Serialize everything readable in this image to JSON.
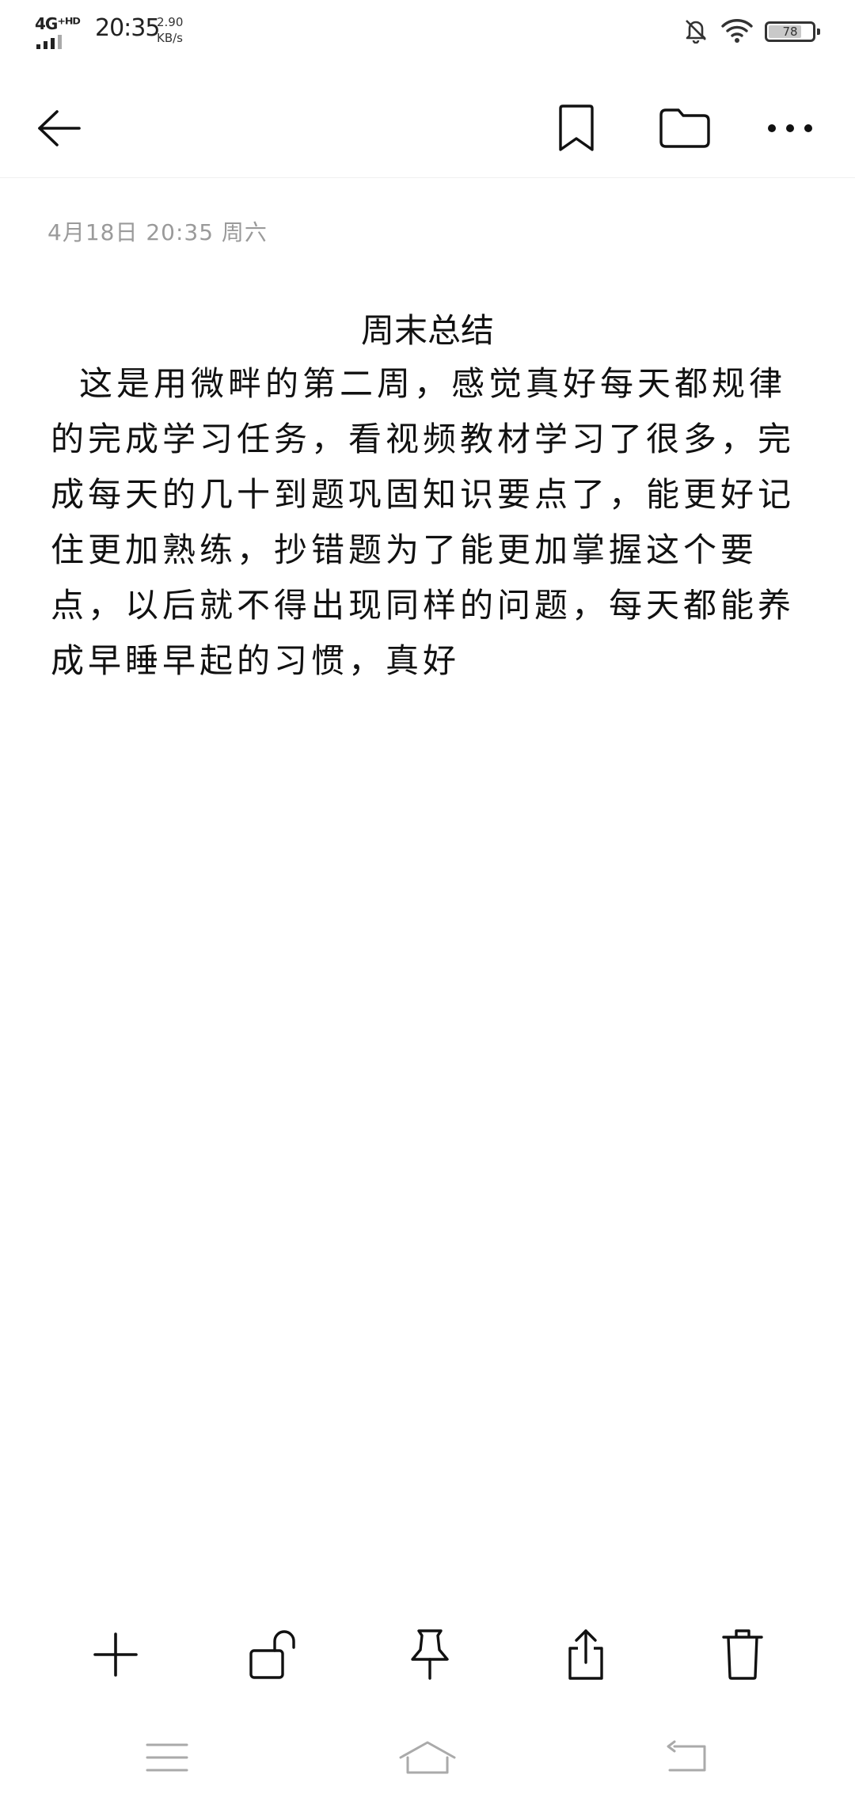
{
  "status_bar": {
    "network_type": "4G⁺ᴴᴰ",
    "time": "20:35",
    "speed_value": "2.90",
    "speed_unit": "KB/s",
    "battery_level": "78"
  },
  "toolbar": {
    "back_icon": "arrow-left-icon",
    "bookmark_icon": "bookmark-icon",
    "folder_icon": "folder-icon",
    "more_icon": "more-icon"
  },
  "note": {
    "meta": "4月18日 20:35 周六",
    "title": "周末总结",
    "body": "这是用微畔的第二周，感觉真好每天都规律的完成学习任务，看视频教材学习了很多，完成每天的几十到题巩固知识要点了，能更好记住更加熟练，抄错题为了能更加掌握这个要点，以后就不得出现同样的问题，每天都能养成早睡早起的习惯，真好"
  },
  "bottom_actions": {
    "icons": [
      "plus-icon",
      "unlock-icon",
      "pin-icon",
      "share-icon",
      "trash-icon"
    ]
  },
  "nav_bar": {
    "icons": [
      "menu-icon",
      "home-icon",
      "back-icon"
    ]
  }
}
